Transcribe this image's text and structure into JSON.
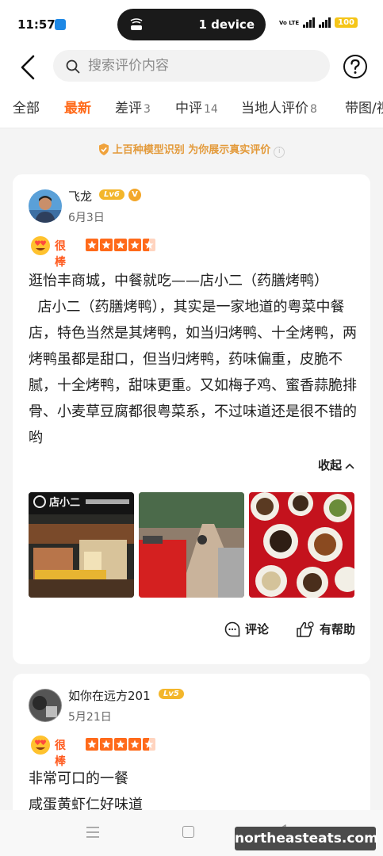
{
  "status_bar": {
    "time": "11:57",
    "device_pill": "1 device",
    "network_label": "Vo LTE",
    "battery": "100"
  },
  "search": {
    "placeholder": "搜索评价内容"
  },
  "tabs": [
    {
      "label": "全部",
      "count": ""
    },
    {
      "label": "最新",
      "count": ""
    },
    {
      "label": "差评",
      "count": "3"
    },
    {
      "label": "中评",
      "count": "14"
    },
    {
      "label": "当地人评价",
      "count": "8"
    },
    {
      "label": "带图/视",
      "count": ""
    }
  ],
  "banner": {
    "text": "上百种模型识别 为你展示真实评价",
    "info_icon": "i"
  },
  "reviews": [
    {
      "user": "飞龙",
      "level": "Lv6",
      "verified": "V",
      "date": "6月3日",
      "rating_label": "很棒",
      "stars": 4.5,
      "text": "逛怡丰商城，中餐就吃——店小二（药膳烤鸭）\n  店小二（药膳烤鸭），其实是一家地道的粤菜中餐店，特色当然是其烤鸭，如当归烤鸭、十全烤鸭，两烤鸭虽都是甜口，但当归烤鸭，药味偏重，皮脆不腻，十全烤鸭，甜味更重。又如梅子鸡、蜜香蒜脆排骨、小麦草豆腐都很粤菜系，不过味道还是很不错的哟",
      "collapse_label": "收起",
      "comment_label": "评论",
      "helpful_label": "有帮助",
      "photo_sign": "店小二"
    },
    {
      "user": "如你在远方201",
      "level": "Lv5",
      "date": "5月21日",
      "rating_label": "很棒",
      "stars": 4.5,
      "text": "非常可口的一餐\n咸蛋黄虾仁好味道"
    }
  ],
  "watermark": "northeasteats.com",
  "colors": {
    "accent": "#ff6a1a",
    "level_badge": "#f3b62b",
    "banner": "#e39a3a"
  }
}
